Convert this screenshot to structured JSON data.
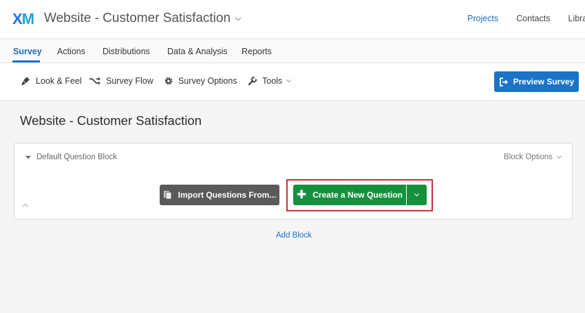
{
  "app": {
    "logo_x": "X",
    "logo_m": "M",
    "project_title": "Website - Customer Satisfaction"
  },
  "top_nav": {
    "items": [
      "Projects",
      "Contacts",
      "Library"
    ],
    "active": "Projects"
  },
  "tabs": {
    "items": [
      "Survey",
      "Actions",
      "Distributions",
      "Data & Analysis",
      "Reports"
    ],
    "active": "Survey"
  },
  "toolbar": {
    "look_feel": "Look & Feel",
    "survey_flow": "Survey Flow",
    "survey_options": "Survey Options",
    "tools": "Tools",
    "preview": "Preview Survey"
  },
  "survey": {
    "title": "Website - Customer Satisfaction"
  },
  "block": {
    "name": "Default Question Block",
    "options_label": "Block Options",
    "import_label": "Import Questions From...",
    "create_label": "Create a New Question"
  },
  "add_block_label": "Add Block",
  "colors": {
    "brand_blue": "#1a73c8",
    "create_green": "#15913d",
    "import_gray": "#5a5a5a",
    "highlight_red": "#c0353b"
  }
}
